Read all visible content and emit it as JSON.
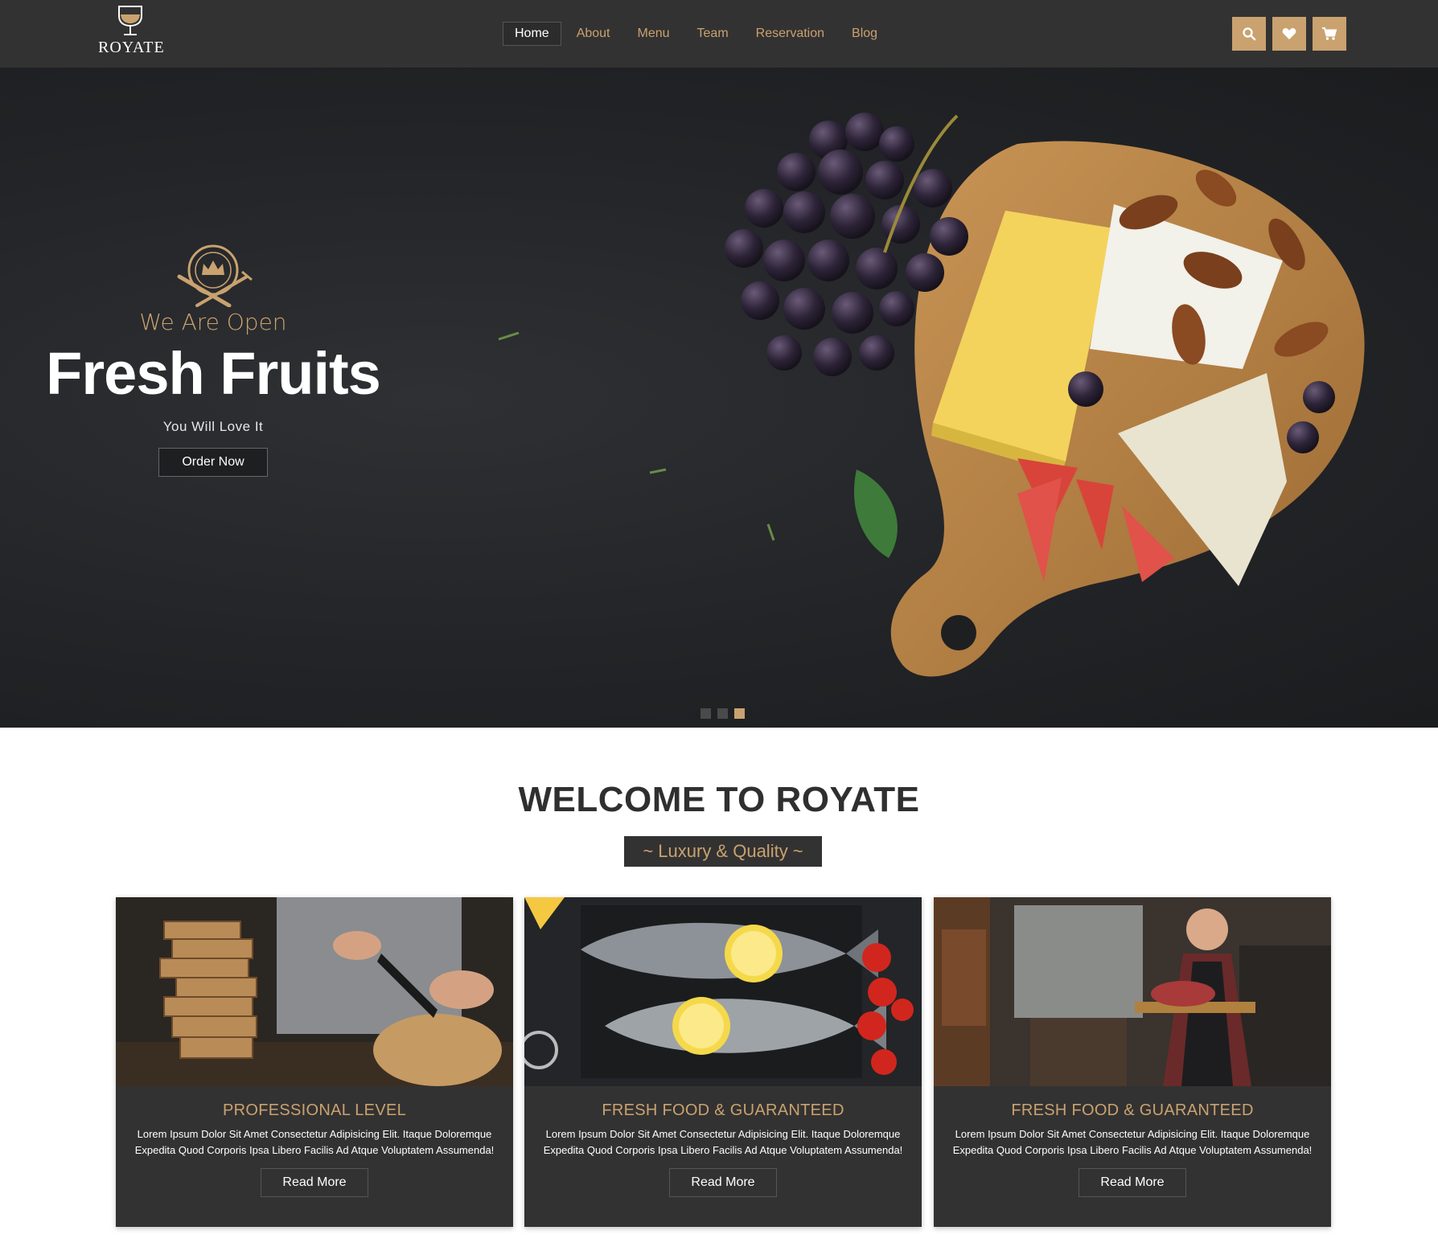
{
  "brand": {
    "name": "ROYATE"
  },
  "nav": {
    "items": [
      {
        "label": "Home",
        "active": true
      },
      {
        "label": "About"
      },
      {
        "label": "Menu"
      },
      {
        "label": "Team"
      },
      {
        "label": "Reservation"
      },
      {
        "label": "Blog"
      }
    ]
  },
  "header_icons": [
    "search-icon",
    "heart-icon",
    "cart-icon"
  ],
  "colors": {
    "accent": "#c9a26f",
    "dark": "#333232",
    "hero_bg": "#222427"
  },
  "hero": {
    "tagline": "We Are Open",
    "title": "Fresh Fruits",
    "subtitle": "You Will Love It",
    "button": "Order Now",
    "slides": 3,
    "active_slide": 3
  },
  "welcome": {
    "title": "WELCOME TO ROYATE",
    "subtitle": "~ Luxury & Quality ~"
  },
  "cards": [
    {
      "title": "PROFESSIONAL LEVEL",
      "text": "Lorem Ipsum Dolor Sit Amet Consectetur Adipisicing Elit. Itaque Doloremque Expedita Quod Corporis Ipsa Libero Facilis Ad Atque Voluptatem Assumenda!",
      "button": "Read More"
    },
    {
      "title": "FRESH FOOD & GUARANTEED",
      "text": "Lorem Ipsum Dolor Sit Amet Consectetur Adipisicing Elit. Itaque Doloremque Expedita Quod Corporis Ipsa Libero Facilis Ad Atque Voluptatem Assumenda!",
      "button": "Read More"
    },
    {
      "title": "FRESH FOOD & GUARANTEED",
      "text": "Lorem Ipsum Dolor Sit Amet Consectetur Adipisicing Elit. Itaque Doloremque Expedita Quod Corporis Ipsa Libero Facilis Ad Atque Voluptatem Assumenda!",
      "button": "Read More"
    }
  ]
}
